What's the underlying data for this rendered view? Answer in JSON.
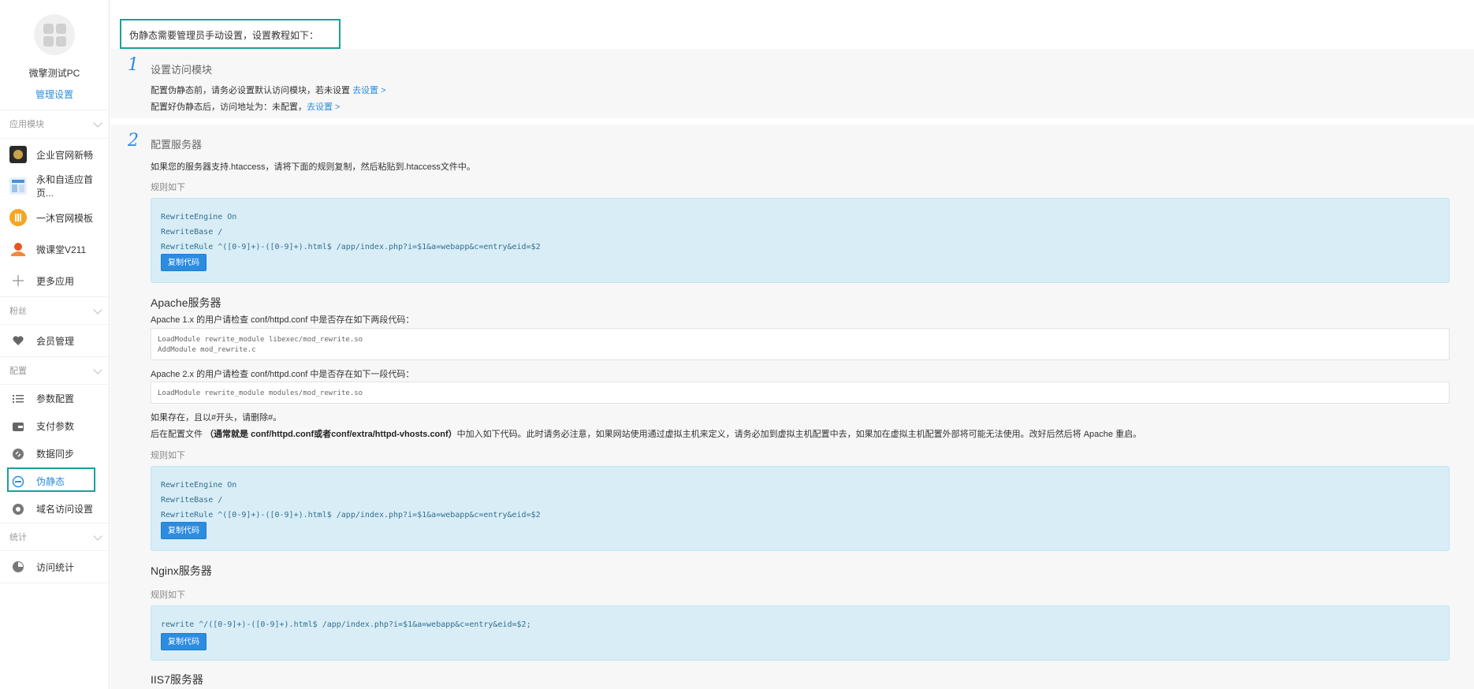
{
  "account": {
    "name": "微擎测试PC",
    "manage_label": "管理设置"
  },
  "sidebar": {
    "groups": [
      {
        "title": "应用模块",
        "items": [
          {
            "label": "企业官网新畅",
            "icon": "app-icon-enterprise"
          },
          {
            "label": "永和自适应首页...",
            "icon": "app-icon-yonghe"
          },
          {
            "label": "一沐官网模板",
            "icon": "app-icon-yimu"
          },
          {
            "label": "微课堂V211",
            "icon": "app-icon-weiketang"
          },
          {
            "label": "更多应用",
            "icon": "plus-icon"
          }
        ]
      },
      {
        "title": "粉丝",
        "items": [
          {
            "label": "会员管理",
            "icon": "heart-icon"
          }
        ]
      },
      {
        "title": "配置",
        "items": [
          {
            "label": "参数配置",
            "icon": "list-icon"
          },
          {
            "label": "支付参数",
            "icon": "payment-icon"
          },
          {
            "label": "数据同步",
            "icon": "sync-icon"
          },
          {
            "label": "伪静态",
            "icon": "rewrite-icon"
          },
          {
            "label": "域名访问设置",
            "icon": "domain-icon"
          }
        ]
      },
      {
        "title": "统计",
        "items": [
          {
            "label": "访问统计",
            "icon": "stats-icon"
          }
        ]
      }
    ]
  },
  "notice": "伪静态需要管理员手动设置，设置教程如下：",
  "step1": {
    "num": "1",
    "title": "设置访问模块",
    "line1_text": "配置伪静态前，请务必设置默认访问模块，若未设置 ",
    "line1_link": "去设置 >",
    "line2_text": "配置好伪静态后，访问地址为：未配置，",
    "line2_link": "去设置 >"
  },
  "step2": {
    "num": "2",
    "title": "配置服务器",
    "intro": "如果您的服务器支持.htaccess，请将下面的规则复制，然后粘贴到.htaccess文件中。",
    "rules_label": "规则如下",
    "htaccess_code": "RewriteEngine On\nRewriteBase /\nRewriteRule ^([0-9]+)-([0-9]+).html$ /app/index.php?i=$1&a=webapp&c=entry&eid=$2",
    "copy_label": "复制代码",
    "apache_title": "Apache服务器",
    "apache1_text": "Apache 1.x 的用户请检查 conf/httpd.conf 中是否存在如下两段代码：",
    "apache1_code": "LoadModule rewrite_module libexec/mod_rewrite.so\nAddModule mod_rewrite.c",
    "apache2_text": "Apache 2.x 的用户请检查 conf/httpd.conf 中是否存在如下一段代码：",
    "apache2_code": "LoadModule rewrite_module modules/mod_rewrite.so",
    "apache_note1": "如果存在，且以#开头，请删除#。",
    "apache_note2_pre": "后在配置文件 ",
    "apache_note2_bold": "（通常就是 conf/httpd.conf或者conf/extra/httpd-vhosts.conf）",
    "apache_note2_post": "中加入如下代码。此时请务必注意，如果网站使用通过虚拟主机来定义，请务必加到虚拟主机配置中去，如果加在虚拟主机配置外部将可能无法使用。改好后然后将 Apache 重启。",
    "apache_rules_label": "规则如下",
    "apache_code": "RewriteEngine On\nRewriteBase /\nRewriteRule ^([0-9]+)-([0-9]+).html$ /app/index.php?i=$1&a=webapp&c=entry&eid=$2",
    "nginx_title": "Nginx服务器",
    "nginx_rules_label": "规则如下",
    "nginx_code": "rewrite ^/([0-9]+)-([0-9]+).html$ /app/index.php?i=$1&a=webapp&c=entry&eid=$2;",
    "iis_title": "IIS7服务器"
  }
}
